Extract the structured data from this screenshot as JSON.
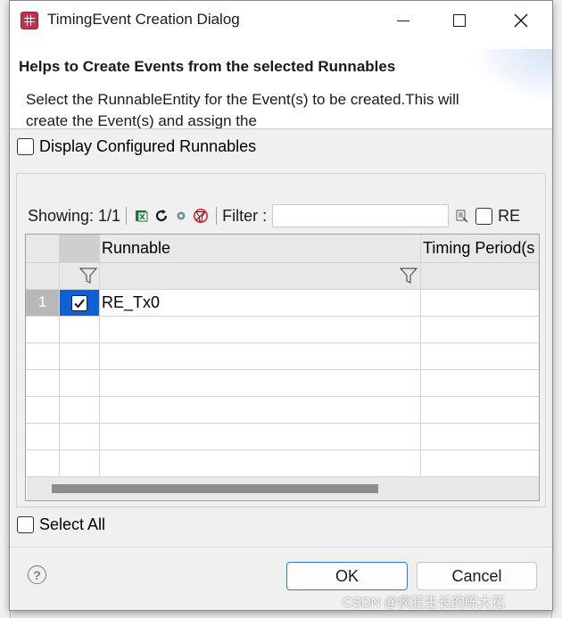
{
  "window": {
    "title": "TimingEvent Creation Dialog"
  },
  "header": {
    "title": "Helps to Create Events from the selected Runnables",
    "description": "Select the RunnableEntity for the Event(s) to be created.This will create the Event(s) and assign the"
  },
  "options": {
    "display_configured_label": "Display Configured Runnables",
    "select_all_label": "Select All"
  },
  "toolbar": {
    "showing_label": "Showing: 1/1",
    "filter_label": "Filter :",
    "filter_value": "",
    "re_label": "RE"
  },
  "table": {
    "columns": [
      "Runnable",
      "Timing Period(s"
    ],
    "rows": [
      {
        "index": "1",
        "checked": true,
        "runnable": "RE_Tx0",
        "timing_period": ""
      }
    ]
  },
  "footer": {
    "ok_label": "OK",
    "cancel_label": "Cancel",
    "help_glyph": "?"
  },
  "watermark": "CSDN @疯狂生长的陈大花",
  "colors": {
    "selection": "#0b62d6",
    "ok_border": "#2d7bd6"
  }
}
